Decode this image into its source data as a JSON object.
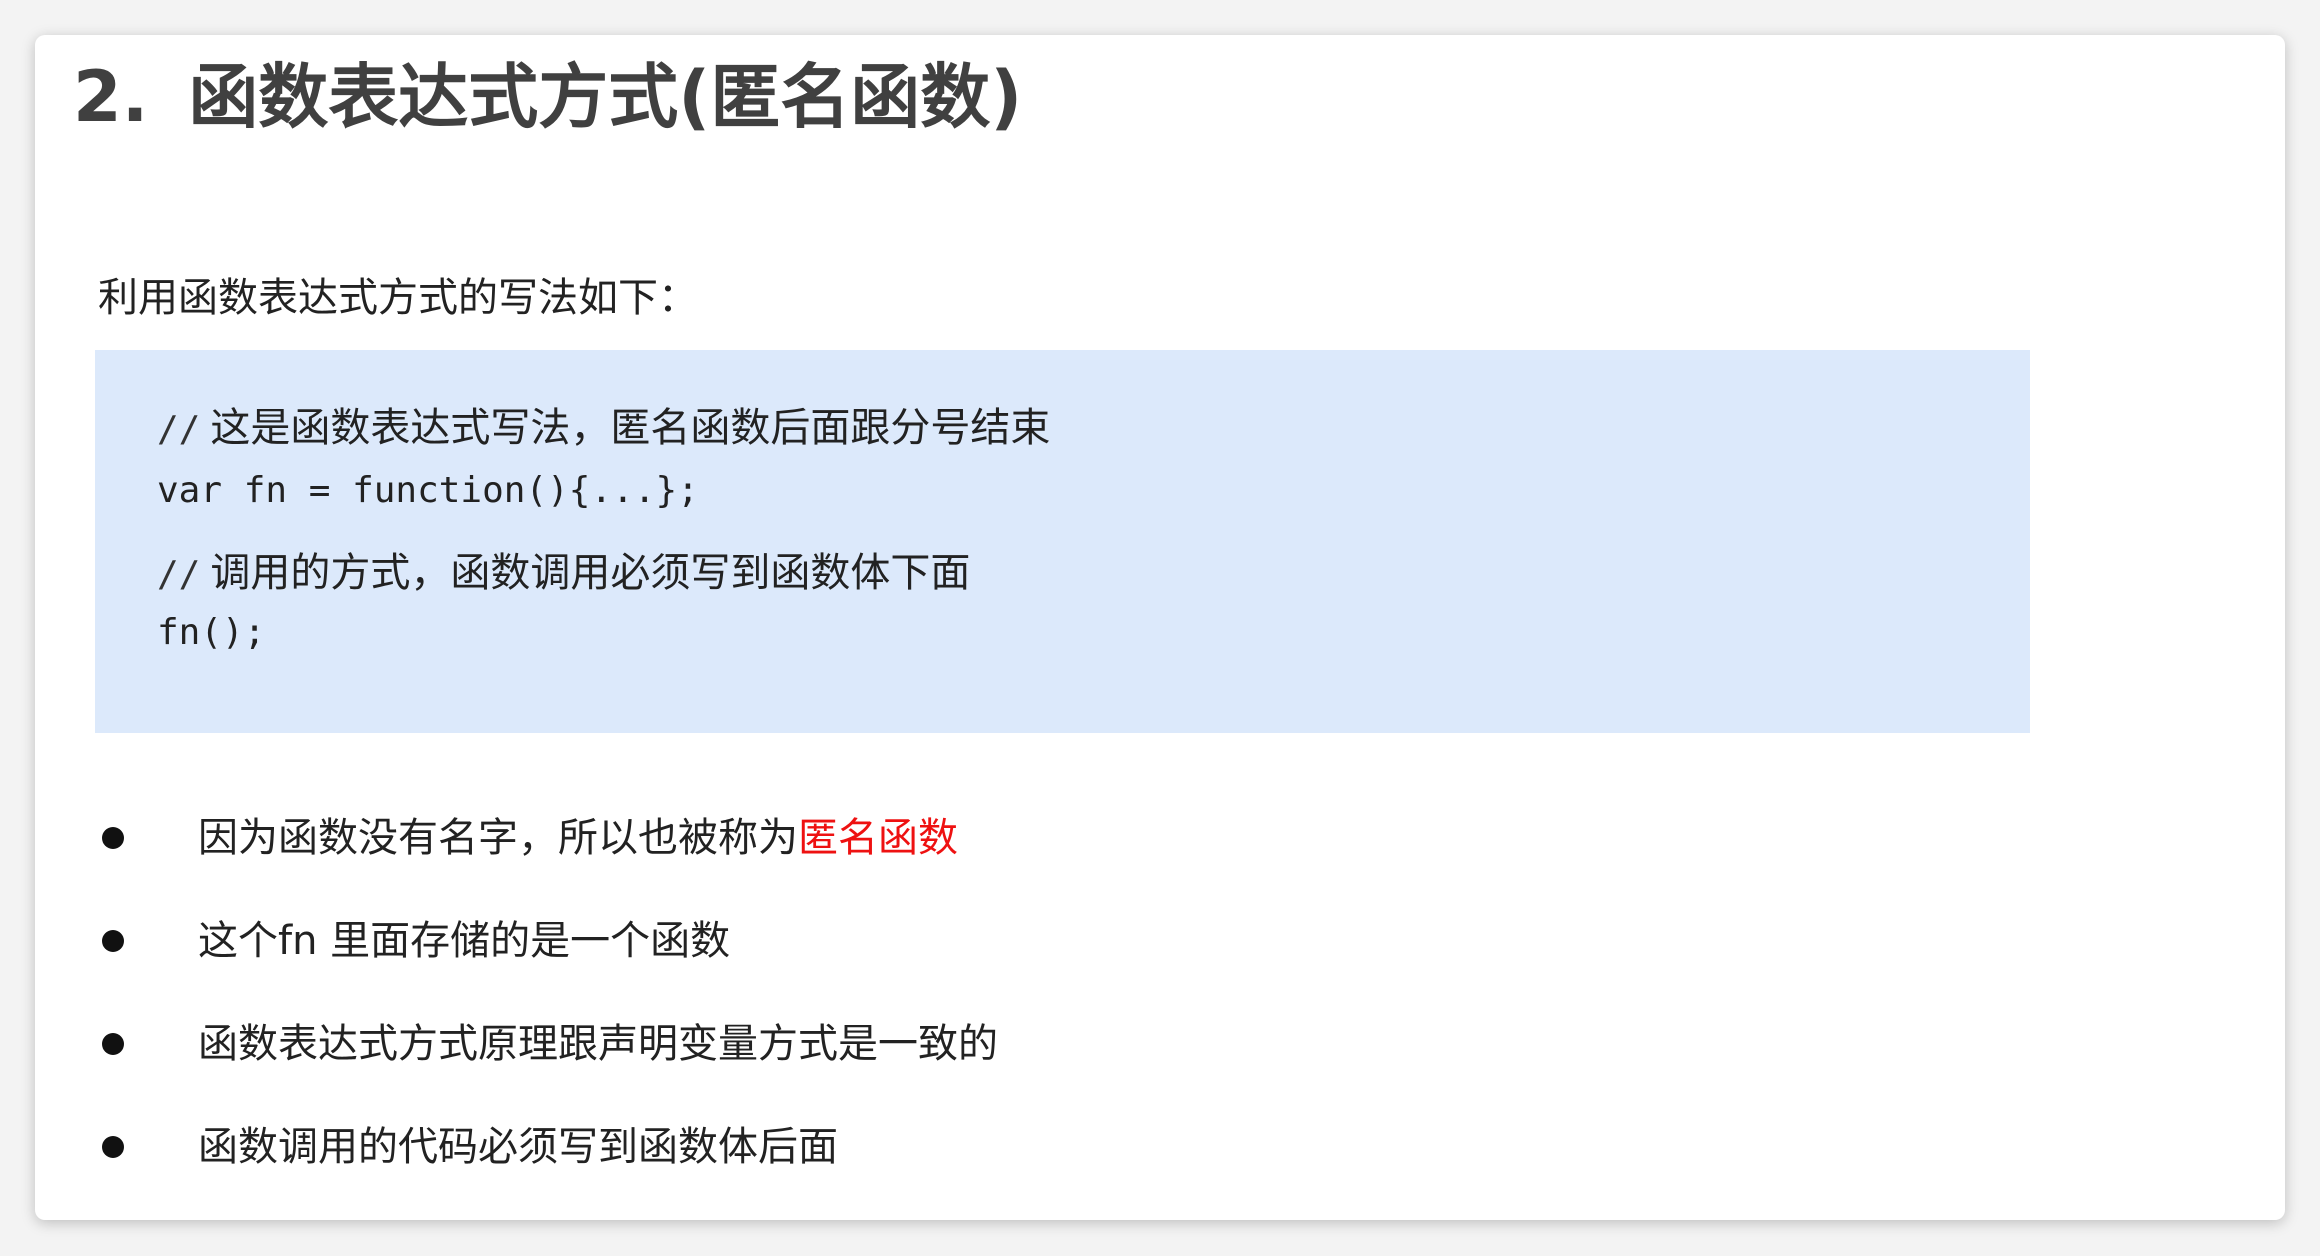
{
  "title": {
    "number": "2.",
    "text": "函数表达式方式(匿名函数)"
  },
  "intro": "利用函数表达式方式的写法如下：",
  "code": {
    "comment_prefix": "//",
    "line1_comment": "这是函数表达式写法，匿名函数后面跟分号结束",
    "line2": "var fn = function(){...};",
    "line3_comment": "调用的方式，函数调用必须写到函数体下面",
    "line4": "fn();"
  },
  "bullets": [
    {
      "text": "因为函数没有名字，所以也被称为",
      "highlight": "匿名函数"
    },
    {
      "text": "这个fn 里面存储的是一个函数"
    },
    {
      "text": "函数表达式方式原理跟声明变量方式是一致的"
    },
    {
      "text": "函数调用的代码必须写到函数体后面"
    }
  ],
  "colors": {
    "code_background": "#dce9fb",
    "highlight": "#ee1111",
    "title": "#404040"
  }
}
